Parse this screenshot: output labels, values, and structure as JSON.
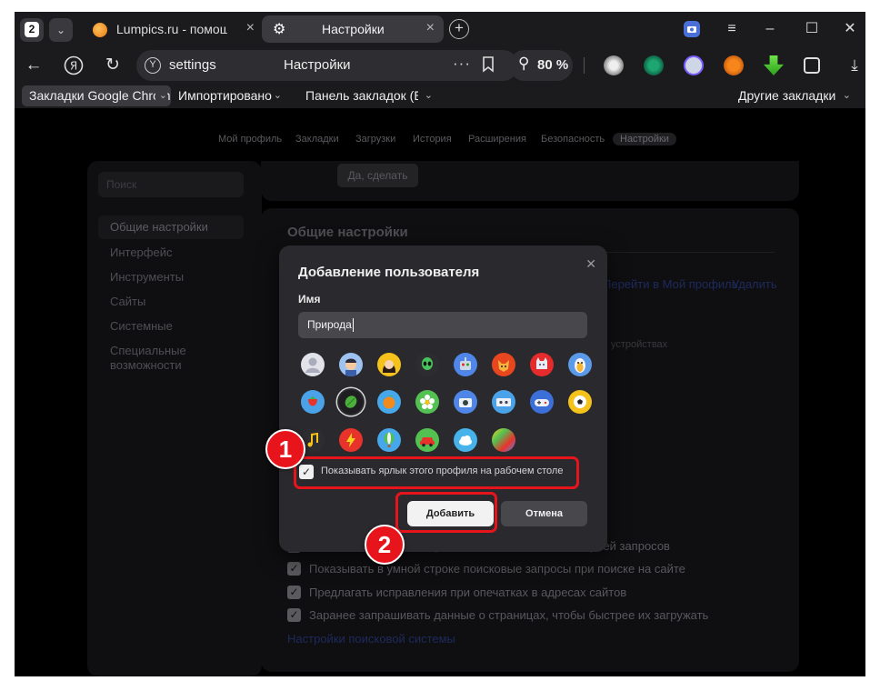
{
  "colors": {
    "accent": "#e8141c",
    "window": "#1b1b1e",
    "modal": "#2a2a2e",
    "input": "#47474c"
  },
  "tabbar": {
    "tab_count": "2",
    "tabs": [
      {
        "title": "Lumpics.ru - помощь с компьютером",
        "icon": "orange-favicon-icon"
      },
      {
        "title": "Настройки",
        "icon": "gear-icon",
        "active": true
      }
    ]
  },
  "navbar": {
    "url": "settings",
    "page_title": "Настройки",
    "zoom": "80 %"
  },
  "bookmarks": {
    "items": [
      "Закладки Google Chrome",
      "Импортировано",
      "Панель закладок (Edge)"
    ],
    "other": "Другие закладки"
  },
  "settings_nav": [
    "Мой профиль",
    "Закладки",
    "Загрузки",
    "История",
    "Расширения",
    "Безопасность",
    "Настройки"
  ],
  "sidebar": {
    "search_placeholder": "Поиск",
    "items": [
      "Общие настройки",
      "Интерфейс",
      "Инструменты",
      "Сайты",
      "Системные",
      "Специальные возможности"
    ]
  },
  "top_card": {
    "button": "Да, сделать"
  },
  "general": {
    "heading": "Общие настройки",
    "profile_link": "Перейти в Мой профиль",
    "delete_link": "Удалить",
    "devices_text": "устройствах",
    "options": [
      "Показывать в умной строке ответы и вместе с историей запросов",
      "Показывать в умной строке поисковые запросы при поиске на сайте",
      "Предлагать исправления при опечатках в адресах сайтов",
      "Заранее запрашивать данные о страницах, чтобы быстрее их загружать"
    ],
    "search_settings_link": "Настройки поисковой системы"
  },
  "modal": {
    "title": "Добавление пользователя",
    "name_label": "Имя",
    "name_value": "Природа",
    "avatars": [
      "user-silhouette-icon",
      "boy-icon",
      "girl-icon",
      "alien-icon",
      "robot-icon",
      "fox-icon",
      "cat-icon",
      "penguin-icon",
      "strawberry-icon",
      "leaf-icon",
      "orange-fruit-icon",
      "flower-icon",
      "camera-icon",
      "cassette-icon",
      "gamepad-icon",
      "soccer-ball-icon",
      "music-note-icon",
      "lightning-icon",
      "hot-air-balloon-icon",
      "car-icon",
      "cloud-icon",
      "gradient-icon"
    ],
    "selected_avatar": "leaf-icon",
    "checkbox_label": "Показывать ярлык этого профиля на рабочем столе",
    "add_button": "Добавить",
    "cancel_button": "Отмена"
  },
  "annotations": {
    "step1": "1",
    "step2": "2"
  }
}
